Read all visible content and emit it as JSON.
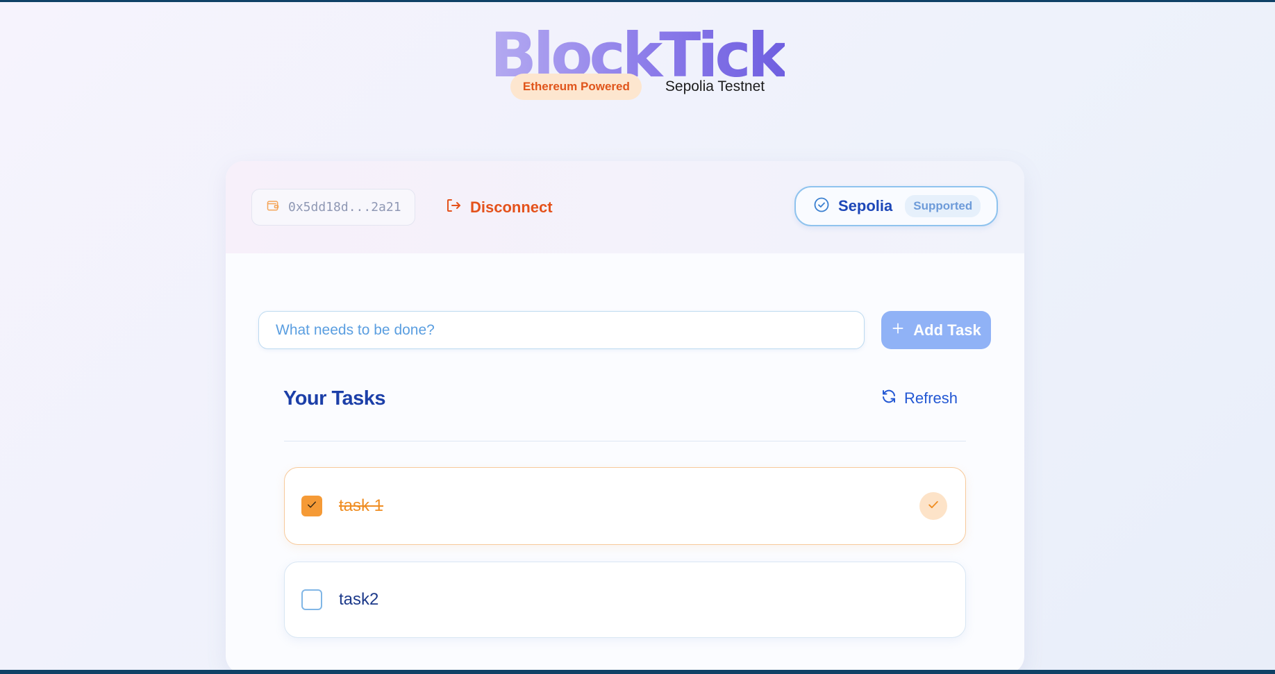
{
  "app": {
    "title": "BlockTick",
    "badge": "Ethereum Powered",
    "network_text": "Sepolia Testnet"
  },
  "header": {
    "wallet_address": "0x5dd18d...2a21",
    "disconnect_label": "Disconnect",
    "network_name": "Sepolia",
    "network_status": "Supported"
  },
  "composer": {
    "placeholder": "What needs to be done?",
    "value": "",
    "add_label": "Add Task"
  },
  "tasks": {
    "title": "Your Tasks",
    "refresh_label": "Refresh",
    "items": [
      {
        "label": "task 1",
        "completed": true
      },
      {
        "label": "task2",
        "completed": false
      }
    ]
  },
  "icons": {
    "wallet": "wallet-icon",
    "disconnect": "logout-icon",
    "network": "check-circle-icon",
    "add": "plus-icon",
    "refresh": "refresh-icon",
    "checkbox_checked": "check-icon",
    "completed_badge": "check-icon"
  },
  "colors": {
    "brand_gradient_start": "#b4aaf1",
    "brand_gradient_end": "#6f5fe0",
    "accent_orange": "#e4521c",
    "accent_blue": "#1d47b8",
    "completed": "#f59a36"
  }
}
